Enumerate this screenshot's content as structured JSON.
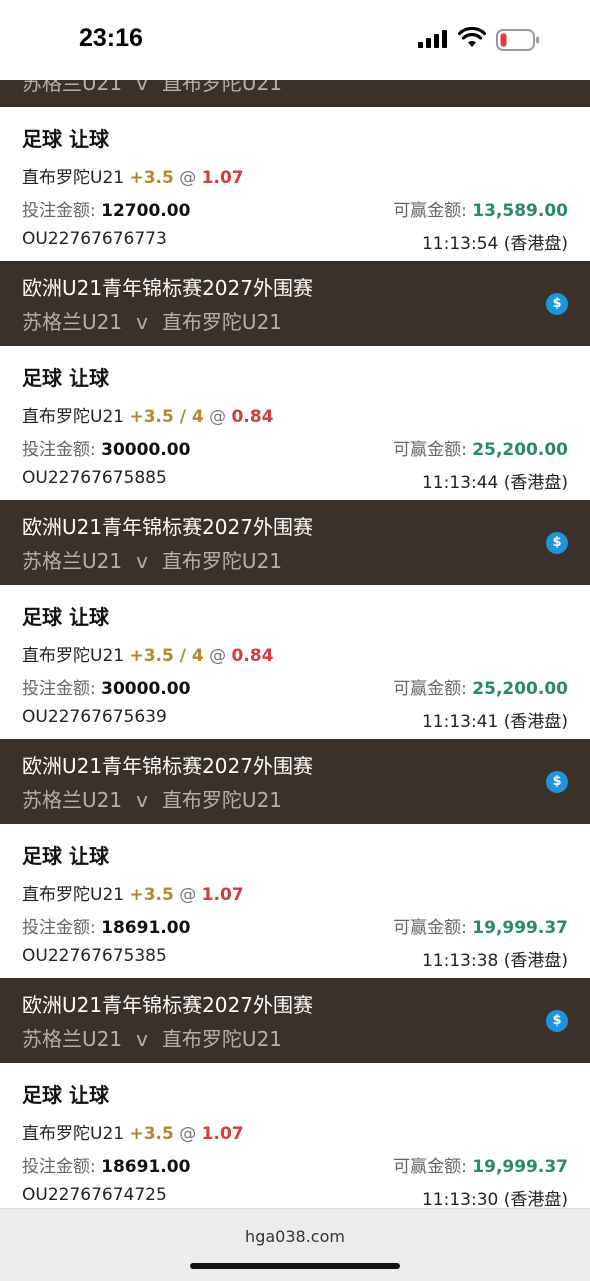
{
  "status": {
    "time": "23:16",
    "colors": {
      "battery_low": "#e53935"
    }
  },
  "top_partial": {
    "team_home": "苏格兰U21",
    "vs": "v",
    "team_away": "直布罗陀U21"
  },
  "bets": [
    {
      "type": "足球 让球",
      "team": "直布罗陀U21",
      "handicap": "+3.5",
      "at": "@",
      "odds": "1.07",
      "stake_label": "投注金额:",
      "stake": "12700.00",
      "win_label": "可赢金额:",
      "win": "13,589.00",
      "id": "OU22767676773",
      "time": "11:13:54 (香港盘)"
    },
    {
      "league": "欧洲U21青年锦标赛2027外围赛",
      "team_home": "苏格兰U21",
      "vs": "v",
      "team_away": "直布罗陀U21",
      "coin": "$",
      "type": "足球 让球",
      "team": "直布罗陀U21",
      "handicap": "+3.5 / 4",
      "at": "@",
      "odds": "0.84",
      "stake_label": "投注金额:",
      "stake": "30000.00",
      "win_label": "可赢金额:",
      "win": "25,200.00",
      "id": "OU22767675885",
      "time": "11:13:44 (香港盘)"
    },
    {
      "league": "欧洲U21青年锦标赛2027外围赛",
      "team_home": "苏格兰U21",
      "vs": "v",
      "team_away": "直布罗陀U21",
      "coin": "$",
      "type": "足球 让球",
      "team": "直布罗陀U21",
      "handicap": "+3.5 / 4",
      "at": "@",
      "odds": "0.84",
      "stake_label": "投注金额:",
      "stake": "30000.00",
      "win_label": "可赢金额:",
      "win": "25,200.00",
      "id": "OU22767675639",
      "time": "11:13:41 (香港盘)"
    },
    {
      "league": "欧洲U21青年锦标赛2027外围赛",
      "team_home": "苏格兰U21",
      "vs": "v",
      "team_away": "直布罗陀U21",
      "coin": "$",
      "type": "足球 让球",
      "team": "直布罗陀U21",
      "handicap": "+3.5",
      "at": "@",
      "odds": "1.07",
      "stake_label": "投注金额:",
      "stake": "18691.00",
      "win_label": "可赢金额:",
      "win": "19,999.37",
      "id": "OU22767675385",
      "time": "11:13:38 (香港盘)"
    },
    {
      "league": "欧洲U21青年锦标赛2027外围赛",
      "team_home": "苏格兰U21",
      "vs": "v",
      "team_away": "直布罗陀U21",
      "coin": "$",
      "type": "足球 让球",
      "team": "直布罗陀U21",
      "handicap": "+3.5",
      "at": "@",
      "odds": "1.07",
      "stake_label": "投注金额:",
      "stake": "18691.00",
      "win_label": "可赢金额:",
      "win": "19,999.37",
      "id": "OU22767674725",
      "time": "11:13:30 (香港盘)"
    }
  ],
  "browser": {
    "url": "hga038.com"
  },
  "colors": {
    "header_bg": "#3a312a",
    "handicap": "#b08a2e",
    "odds": "#d23c3c",
    "win": "#2a8a66",
    "coin": "#1f95d9"
  }
}
